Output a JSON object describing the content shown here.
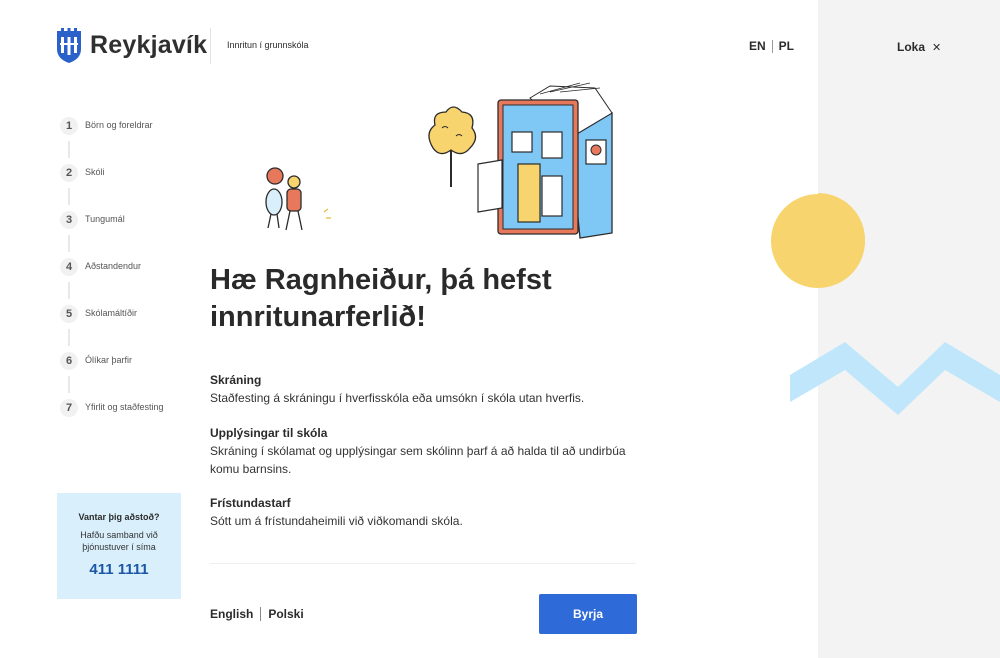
{
  "header": {
    "brand": "Reykjavík",
    "title": "Innritun í grunnskóla",
    "languages": [
      "EN",
      "PL"
    ],
    "close_label": "Loka",
    "close_icon": "close-icon"
  },
  "steps": [
    {
      "number": "1",
      "label": "Börn og foreldrar"
    },
    {
      "number": "2",
      "label": "Skóli"
    },
    {
      "number": "3",
      "label": "Tungumál"
    },
    {
      "number": "4",
      "label": "Aðstandendur"
    },
    {
      "number": "5",
      "label": "Skólamáltíðir"
    },
    {
      "number": "6",
      "label": "Ólíkar þarfir"
    },
    {
      "number": "7",
      "label": "Yfirlit og staðfesting"
    }
  ],
  "help": {
    "title": "Vantar þig aðstoð?",
    "text": "Hafðu samband við þjónustuver í síma",
    "phone": "411 1111"
  },
  "main": {
    "heading": "Hæ Ragnheiður, þá hefst innritunarferlið!",
    "sections": [
      {
        "title": "Skráning",
        "text": "Staðfesting á skráningu í hverfisskóla eða umsókn í skóla utan hverfis."
      },
      {
        "title": "Upplýsingar til skóla",
        "text": "Skráning í skólamat og upplýsingar sem skólinn þarf á að halda til að undirbúa komu barnsins."
      },
      {
        "title": "Frístundastarf",
        "text": "Sótt um á frístundaheimili við viðkomandi skóla."
      }
    ]
  },
  "footer": {
    "languages": [
      "English",
      "Polski"
    ],
    "start_label": "Byrja"
  },
  "colors": {
    "accent": "#2f6ad9",
    "help_bg": "#d9f0fc",
    "phone": "#1c56a6",
    "sun": "#f7d46d",
    "zigzag": "#bfe6fb",
    "side_panel": "#f3f3f3"
  }
}
